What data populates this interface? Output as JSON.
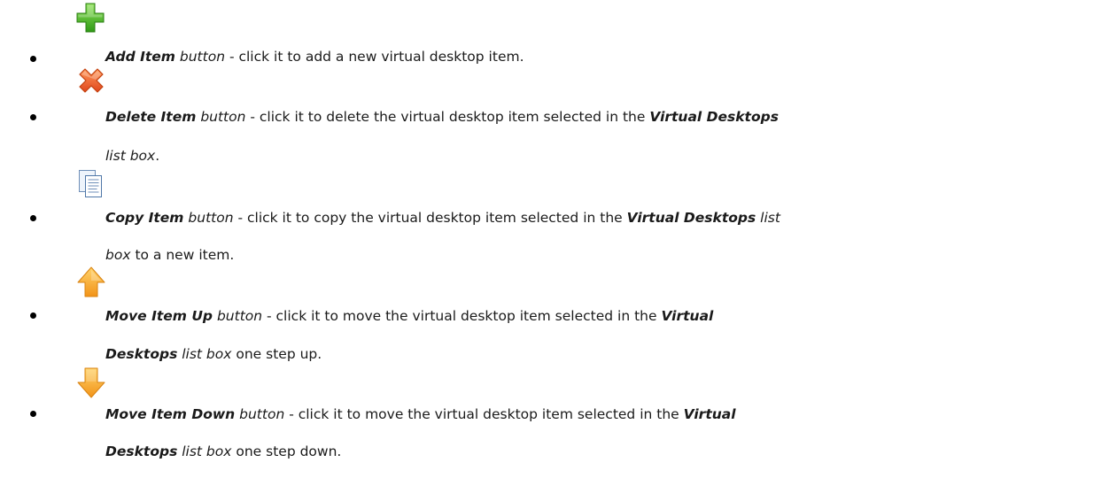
{
  "items": [
    {
      "icon": "add-icon",
      "name": "Add Item",
      "kind": "button",
      "sep": " - ",
      "desc": "click it to add a new virtual desktop item."
    },
    {
      "icon": "delete-icon",
      "name": "Delete Item",
      "kind": "button",
      "sep": " - ",
      "desc": "click it to delete the virtual desktop item selected in the",
      "ref": "Virtual Desktops",
      "ref_kind": "list box",
      "tail": "."
    },
    {
      "icon": "copy-icon",
      "name": "Copy Item",
      "kind": "button",
      "sep": " - ",
      "desc": "click it to copy the virtual desktop item selected in the",
      "ref": "Virtual Desktops",
      "ref_kind_a": "list",
      "ref_kind_b": "box",
      "tail": "to a new item."
    },
    {
      "icon": "arrow-up-icon",
      "name": "Move Item Up",
      "kind": "button",
      "sep": " - ",
      "desc": "click it to move the virtual desktop item selected in the",
      "ref_a": "Virtual",
      "ref_b": "Desktops",
      "ref_kind": "list box",
      "tail": "one step up."
    },
    {
      "icon": "arrow-down-icon",
      "name": "Move Item Down",
      "kind": "button",
      "sep": " - ",
      "desc": "click it to move the virtual desktop item selected in the",
      "ref_a": "Virtual",
      "ref_b": "Desktops",
      "ref_kind": "list box",
      "tail": "one step down."
    }
  ]
}
